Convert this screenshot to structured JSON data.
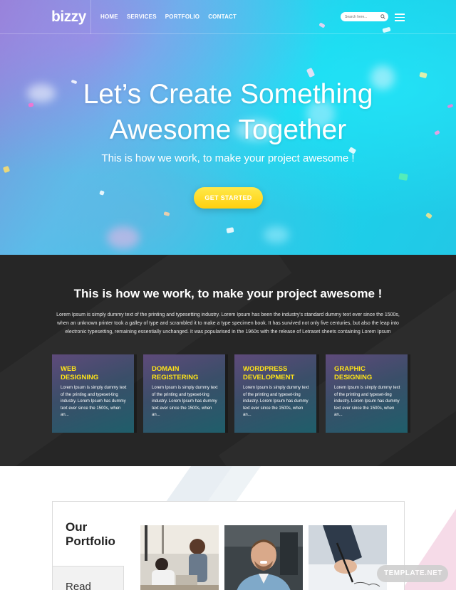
{
  "nav": {
    "logo": "bizzy",
    "items": [
      "HOME",
      "SERVICES",
      "PORTFOLIO",
      "CONTACT"
    ],
    "search_placeholder": "Search here..."
  },
  "hero": {
    "title_line1": "Let’s Create Something",
    "title_line2": "Awesome Together",
    "subtitle": "This is how we work, to make your project awesome !",
    "cta_label": "GET STARTED"
  },
  "services": {
    "title": "This is how we work, to make your project awesome !",
    "text": "Lorem Ipsum is simply dummy text of the printing and typesetting industry. Lorem Ipsum has been the industry's standard dummy text ever since the 1500s, when an unknown printer took a galley of type and scrambled it to make a type specimen book. It has survived not only five centuries, but also the leap into electronic typesetting, remaining essentially unchanged. It was popularised in the 1960s with the release of Letraset sheets containing Lorem Ipsum",
    "cards": [
      {
        "title_line1": "WEB",
        "title_line2": "DESIGNING",
        "text": "Lorem Ipsum is simply dummy text of the printing and typeset-ting industry. Lorem Ipsum has dummy text ever since the 1500s, when an..."
      },
      {
        "title_line1": "DOMAIN",
        "title_line2": "REGISTERING",
        "text": "Lorem Ipsum is simply dummy text of the printing and typeset-ting industry. Lorem Ipsum has dummy text ever since the 1500s, when an..."
      },
      {
        "title_line1": "WORDPRESS",
        "title_line2": "DEVELOPMENT",
        "text": "Lorem Ipsum is simply dummy text of the printing and typeset-ting industry. Lorem Ipsum has dummy text ever since the 1500s, when an..."
      },
      {
        "title_line1": "GRAPHIC",
        "title_line2": "DESIGNING",
        "text": "Lorem Ipsum is simply dummy text of the printing and typeset-ting industry. Lorem Ipsum has dummy text ever since the 1500s, when an..."
      }
    ]
  },
  "portfolio": {
    "title_line1": "Our",
    "title_line2": "Portfolio",
    "read_label": "Read"
  },
  "watermark": "TEMPLATE.NET",
  "colors": {
    "accent_yellow": "#ffe318",
    "cta_yellow": "#ffd41e",
    "dark_bg": "#262626",
    "hero_cyan": "#19d4ec"
  }
}
